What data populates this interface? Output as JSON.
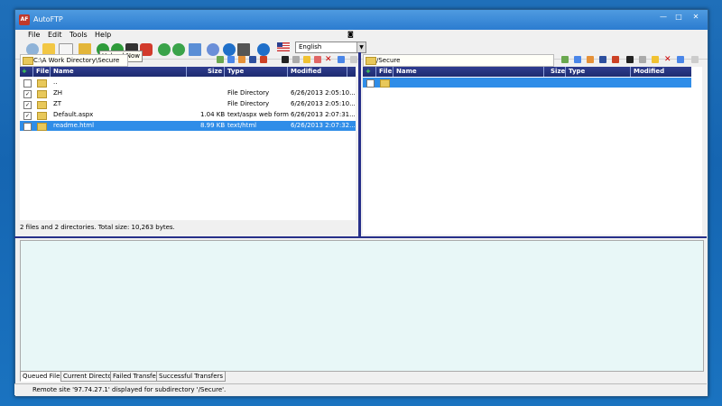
{
  "window": {
    "title": "AutoFTP",
    "app_icon_text": "AF"
  },
  "menu": [
    "File",
    "Edit",
    "Tools",
    "Help"
  ],
  "toolbar": {
    "language": "English",
    "tooltip": "Upload Now",
    "icon_names": [
      "connect-icon",
      "wizard-icon",
      "new-site-icon",
      "edit-icon",
      "download-icon",
      "upload-icon",
      "traffic-light-icon",
      "stop-icon",
      "sync-left-icon",
      "sync-right-icon",
      "schedule-icon",
      "settings-icon",
      "help-icon",
      "monitor-icon",
      "info-icon",
      "flag-icon"
    ]
  },
  "local": {
    "path": "C:\\A Work Directory\\Secure",
    "columns": [
      "File",
      "Name",
      "Size",
      "Type",
      "Modified"
    ],
    "rows": [
      {
        "checked": "",
        "name": "..",
        "size": "",
        "type": "",
        "modified": "",
        "selected": false
      },
      {
        "checked": "✓",
        "name": "ZH",
        "size": "",
        "type": "File Directory",
        "modified": "6/26/2013 2:05:10...",
        "selected": false
      },
      {
        "checked": "✓",
        "name": "ZT",
        "size": "",
        "type": "File Directory",
        "modified": "6/26/2013 2:05:10...",
        "selected": false
      },
      {
        "checked": "✓",
        "name": "Default.aspx",
        "size": "1.04 KB",
        "type": "text/aspx web form",
        "modified": "6/26/2013 2:07:31...",
        "selected": false
      },
      {
        "checked": "",
        "name": "readme.html",
        "size": "8.99 KB",
        "type": "text/html",
        "modified": "6/26/2013 2:07:32...",
        "selected": true
      }
    ],
    "status": "2 files and 2 directories. Total size: 10,263 bytes."
  },
  "remote": {
    "path": "/Secure",
    "columns": [
      "File",
      "Name",
      "Size",
      "Type",
      "Modified"
    ],
    "rows": [
      {
        "checked": "",
        "name": "",
        "size": "",
        "type": "",
        "modified": "",
        "selected": true
      }
    ]
  },
  "queue_tabs": [
    "Queued Files",
    "Current Directory",
    "Failed Transfers",
    "Successful Transfers"
  ],
  "statusbar": "Remote site '97.74.27.1' displayed for subdirectory '/Secure'.",
  "colors": {
    "header": "#1e2b70",
    "selection": "#2f8de8",
    "splitter": "#27308a",
    "queue_bg": "#e8f7f7"
  }
}
